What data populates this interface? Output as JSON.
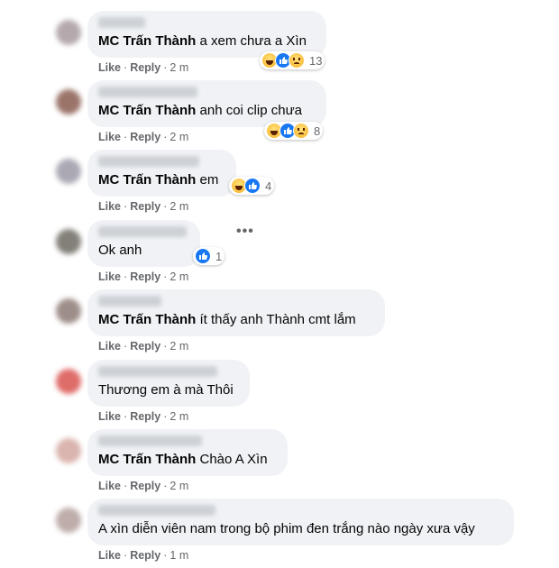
{
  "actions": {
    "like": "Like",
    "reply": "Reply",
    "separator": "·"
  },
  "comments": [
    {
      "tag": "MC Trấn Thành",
      "text": " a xem chưa a Xìn",
      "time": "2 m",
      "reactions": {
        "icons": [
          "haha-icon",
          "like-icon",
          "sad-icon"
        ],
        "count": "13"
      }
    },
    {
      "tag": "MC Trấn Thành",
      "text": " anh coi clip chưa",
      "time": "2 m",
      "reactions": {
        "icons": [
          "haha-icon",
          "like-icon",
          "sad-icon"
        ],
        "count": "8"
      }
    },
    {
      "tag": "MC Trấn Thành",
      "text": " em",
      "time": "2 m",
      "reactions": {
        "icons": [
          "haha-icon",
          "like-icon"
        ],
        "count": "4"
      }
    },
    {
      "tag": "",
      "text": "Ok anh",
      "time": "2 m",
      "reactions": {
        "icons": [
          "like-icon"
        ],
        "count": "1"
      },
      "more": "•••"
    },
    {
      "tag": "MC Trấn Thành",
      "text": " ít thấy anh Thành cmt lắm",
      "time": "2 m"
    },
    {
      "tag": "",
      "text": "Thương em à mà Thôi",
      "time": "2 m"
    },
    {
      "tag": "MC Trấn Thành",
      "text": " Chào A Xìn",
      "time": "2 m"
    },
    {
      "tag": "",
      "text": "A xìn diễn viên nam trong bộ phim đen trắng nào ngày xưa vậy",
      "time": "1 m"
    }
  ],
  "colors": {
    "bubble": "#f0f2f5",
    "meta": "#65676b",
    "like_blue": "#1877f2",
    "haha_yellow": "#f7b125"
  }
}
